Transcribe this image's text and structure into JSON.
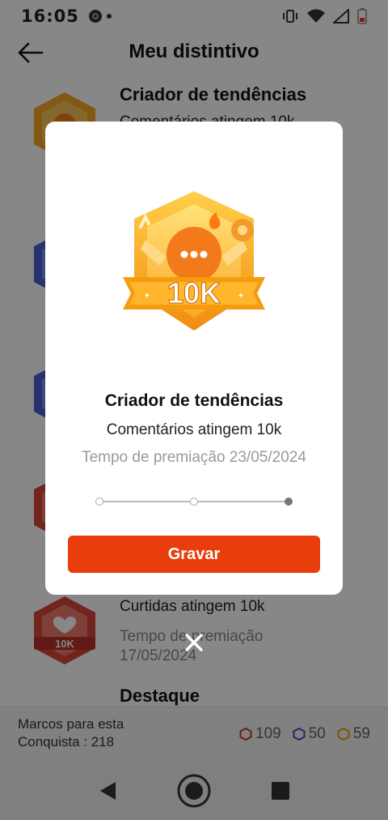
{
  "status_bar": {
    "time": "16:05"
  },
  "header": {
    "title": "Meu distintivo"
  },
  "badges": [
    {
      "title": "Criador de tendências",
      "desc": "Comentários atingem 10k"
    },
    {
      "title": "",
      "desc": ""
    },
    {
      "title": "",
      "desc": ""
    },
    {
      "title": "",
      "desc": ""
    },
    {
      "title": "",
      "desc": "Curtidas atingem 10k",
      "time": "Tempo de premiação 17/05/2024",
      "badge_text": "10K"
    },
    {
      "title": "Destaque"
    }
  ],
  "footer": {
    "milestone_label": "Marcos para esta Conquista : 218",
    "counts": [
      {
        "value": "109",
        "color": "#c0392b"
      },
      {
        "value": "50",
        "color": "#3d4fc4"
      },
      {
        "value": "59",
        "color": "#e6a100"
      }
    ]
  },
  "modal": {
    "badge_text": "10K",
    "title": "Criador de tendências",
    "description": "Comentários atingem 10k",
    "award_time": "Tempo de premiação 23/05/2024",
    "progress_steps": 3,
    "active_step": 3,
    "button_label": "Gravar"
  },
  "colors": {
    "accent": "#ea3d0d",
    "badge_gold": "#f5a623"
  }
}
